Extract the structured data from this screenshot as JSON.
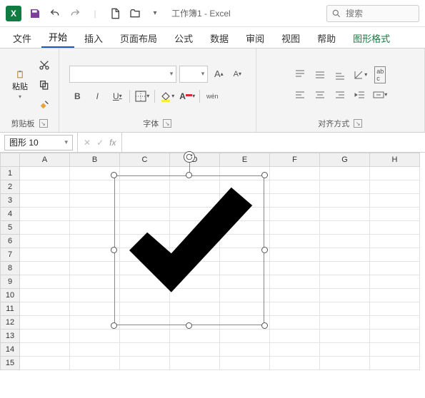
{
  "titlebar": {
    "doc_title": "工作簿1 - Excel",
    "search_placeholder": "搜索"
  },
  "tabs": {
    "file": "文件",
    "home": "开始",
    "insert": "插入",
    "layout": "页面布局",
    "formulas": "公式",
    "data": "数据",
    "review": "审阅",
    "view": "视图",
    "help": "帮助",
    "shape_format": "图形格式"
  },
  "ribbon": {
    "clipboard": {
      "paste": "粘贴",
      "label": "剪贴板"
    },
    "font": {
      "label": "字体",
      "bold": "B",
      "italic": "I",
      "underline": "U",
      "wen": "wén"
    },
    "align": {
      "label": "对齐方式"
    }
  },
  "fx": {
    "name_box": "图形 10",
    "fx_label": "fx"
  },
  "grid": {
    "columns": [
      "A",
      "B",
      "C",
      "D",
      "E",
      "F",
      "G",
      "H"
    ],
    "rows": [
      "1",
      "2",
      "3",
      "4",
      "5",
      "6",
      "7",
      "8",
      "9",
      "10",
      "11",
      "12",
      "13",
      "14",
      "15"
    ]
  },
  "shape": {
    "type": "checkmark",
    "fill": "#000000",
    "selected": true
  }
}
